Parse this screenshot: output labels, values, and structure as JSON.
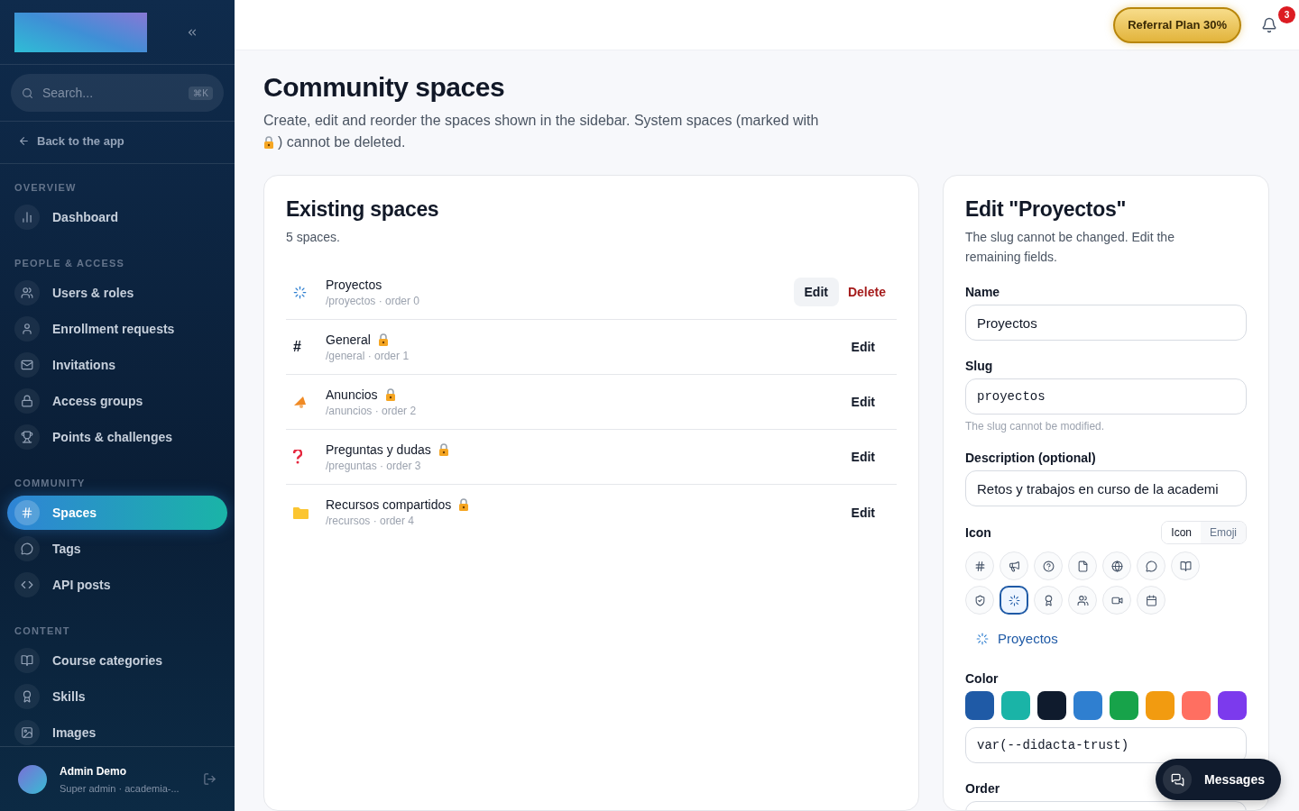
{
  "sidebar": {
    "search": {
      "placeholder": "Search...",
      "shortcut": "⌘K"
    },
    "back_link": "Back to the app",
    "sections": [
      {
        "title": "OVERVIEW",
        "items": [
          {
            "label": "Dashboard",
            "selected": false
          }
        ]
      },
      {
        "title": "PEOPLE & ACCESS",
        "items": [
          {
            "label": "Users & roles",
            "selected": false
          },
          {
            "label": "Enrollment requests",
            "selected": false
          },
          {
            "label": "Invitations",
            "selected": false
          },
          {
            "label": "Access groups",
            "selected": false
          },
          {
            "label": "Points & challenges",
            "selected": false
          }
        ]
      },
      {
        "title": "COMMUNITY",
        "items": [
          {
            "label": "Spaces",
            "selected": true
          },
          {
            "label": "Tags",
            "selected": false
          },
          {
            "label": "API posts",
            "selected": false
          }
        ]
      },
      {
        "title": "CONTENT",
        "items": [
          {
            "label": "Course categories",
            "selected": false
          },
          {
            "label": "Skills",
            "selected": false
          },
          {
            "label": "Images",
            "selected": false
          }
        ]
      }
    ],
    "user": {
      "name": "Admin Demo",
      "role": "Super admin · academia-..."
    }
  },
  "topbar": {
    "referral": "Referral Plan 30%",
    "notifications": "3"
  },
  "page": {
    "title": "Community spaces",
    "description_before": "Create, edit and reorder the spaces shown in the sidebar. System spaces (marked with",
    "description_after": ") cannot be deleted."
  },
  "spaces_card": {
    "title": "Existing spaces",
    "count": "5 spaces.",
    "rows": [
      {
        "kind": "spinner",
        "name": "Proyectos",
        "meta": "/proyectos · order 0",
        "system": false,
        "selected": true,
        "edit": "Edit",
        "delete": "Delete"
      },
      {
        "kind": "hash",
        "icon_text": "#",
        "name": "General",
        "meta": "/general · order 1",
        "system": true,
        "selected": false,
        "edit": "Edit"
      },
      {
        "kind": "megaphone",
        "name": "Anuncios",
        "meta": "/anuncios · order 2",
        "system": true,
        "selected": false,
        "edit": "Edit"
      },
      {
        "kind": "question",
        "name": "Preguntas y dudas",
        "meta": "/preguntas · order 3",
        "system": true,
        "selected": false,
        "edit": "Edit"
      },
      {
        "kind": "folder",
        "name": "Recursos compartidos",
        "meta": "/recursos · order 4",
        "system": true,
        "selected": false,
        "edit": "Edit"
      }
    ]
  },
  "edit_card": {
    "title": "Edit \"Proyectos\"",
    "subtitle": "The slug cannot be changed. Edit the remaining fields.",
    "name_label": "Name",
    "name_value": "Proyectos",
    "slug_label": "Slug",
    "slug_value": "proyectos",
    "slug_hint": "The slug cannot be modified.",
    "description_label": "Description (optional)",
    "description_value": "Retos y trabajos en curso de la academi",
    "icon_label": "Icon",
    "icon_modes": [
      {
        "label": "Icon",
        "selected": true
      },
      {
        "label": "Emoji",
        "selected": false
      }
    ],
    "icons": [
      {
        "selected": false
      },
      {
        "selected": false
      },
      {
        "selected": false
      },
      {
        "selected": false
      },
      {
        "selected": false
      },
      {
        "selected": false
      },
      {
        "selected": false
      },
      {
        "selected": false
      },
      {
        "selected": true
      },
      {
        "selected": false
      },
      {
        "selected": false
      },
      {
        "selected": false
      },
      {
        "selected": false
      }
    ],
    "preview": "Proyectos",
    "color_label": "Color",
    "colors": [
      {
        "color": "#1f5aa6"
      },
      {
        "color": "#1ab4a7"
      },
      {
        "color": "#0f1b2d"
      },
      {
        "color": "#2f7fd0"
      },
      {
        "color": "#17a34a"
      },
      {
        "color": "#f29b10"
      },
      {
        "color": "#ff6f61"
      },
      {
        "color": "#7c3aed"
      }
    ],
    "color_value": "var(--didacta-trust)",
    "order_label": "Order"
  },
  "messages_button": "Messages"
}
